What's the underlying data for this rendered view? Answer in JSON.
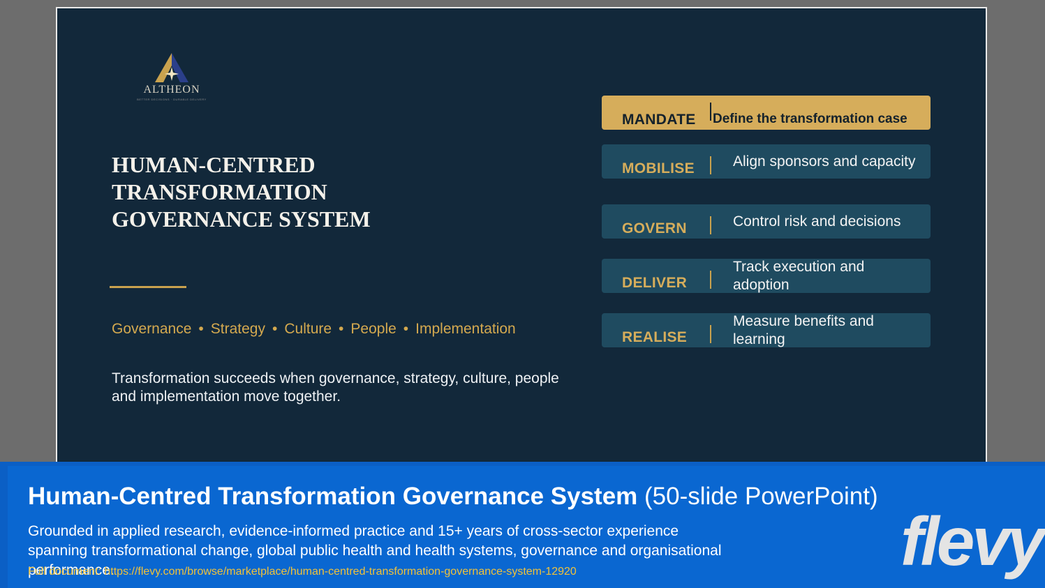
{
  "slide": {
    "logo": {
      "name": "ALTHEON",
      "tagline": "BETTER DECISIONS · DURABLE DELIVERY"
    },
    "title": "HUMAN-CENTRED TRANSFORMATION GOVERNANCE SYSTEM",
    "pillars": [
      "Governance",
      "Strategy",
      "Culture",
      "People",
      "Implementation"
    ],
    "pillar_separator": "•",
    "tagline": "Transformation succeeds when governance, strategy, culture, people and implementation move together.",
    "stages": [
      {
        "key": "MANDATE",
        "desc": "Define the transformation case",
        "active": true
      },
      {
        "key": "MOBILISE",
        "desc": "Align sponsors and capacity",
        "active": false
      },
      {
        "key": "GOVERN",
        "desc": "Control risk and decisions",
        "active": false
      },
      {
        "key": "DELIVER",
        "desc": "Track execution and adoption",
        "active": false
      },
      {
        "key": "REALISE",
        "desc": "Measure benefits and learning",
        "active": false
      }
    ]
  },
  "footer": {
    "title_bold": "Human-Centred Transformation Governance System",
    "title_suffix": "(50-slide PowerPoint)",
    "description": "Grounded in applied research, evidence-informed practice and 15+ years of cross-sector experience spanning transformational change, global public health and health systems, governance and organisational performance.",
    "link": "Full document: https://flevy.com/browse/marketplace/human-centred-transformation-governance-system-12920",
    "brand": "flevy"
  },
  "colors": {
    "slide_bg": "#12283a",
    "gold": "#d6ad5b",
    "stage_bg": "#1f4b60",
    "footer_bg": "#0a67d1",
    "link": "#f0c23a"
  }
}
